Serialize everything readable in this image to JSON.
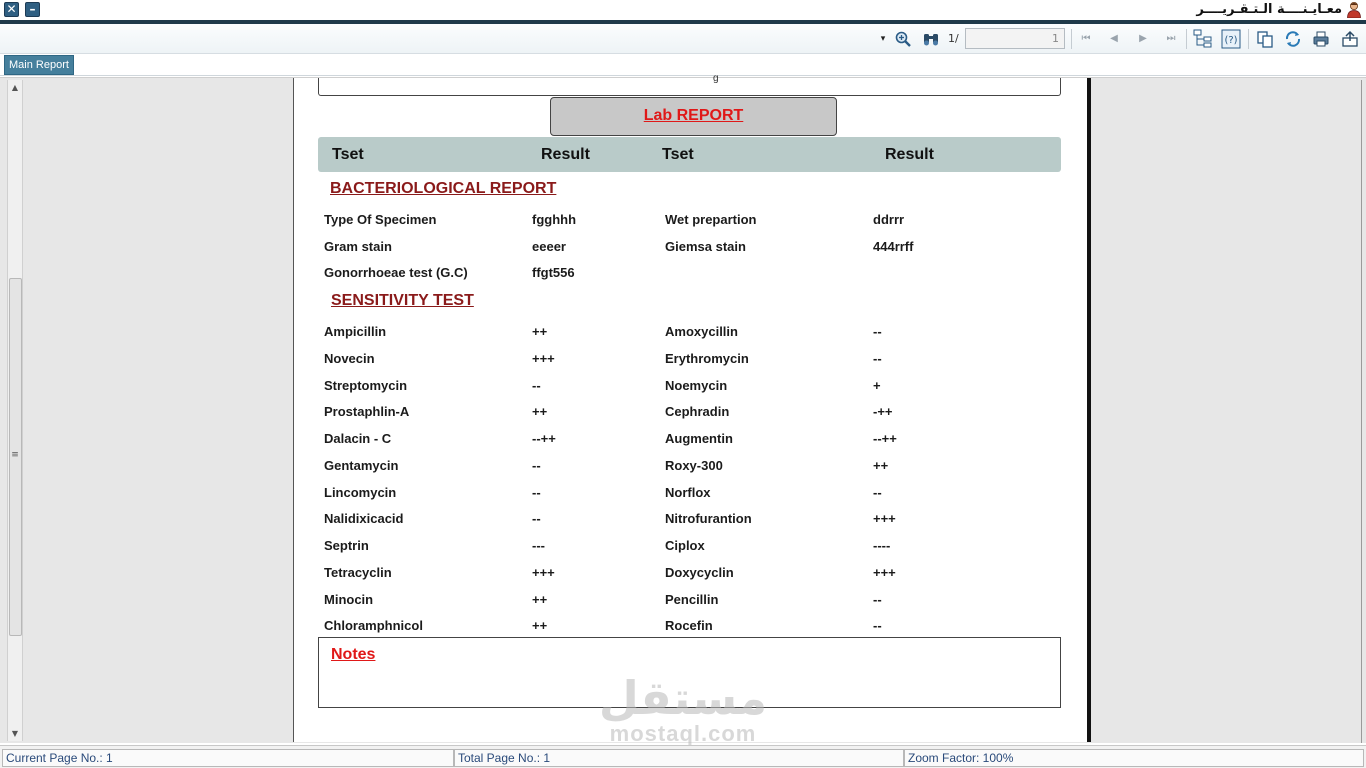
{
  "window": {
    "title": "معـايـنــــة الـتـقـريــــر",
    "close_glyph": "✕",
    "minimize_glyph": "–",
    "user_icon": "user-icon"
  },
  "toolbar": {
    "page_of_label": "1/",
    "page_input_value": "1",
    "icons": [
      "dropdown-arrow-icon",
      "zoom-icon",
      "search-binoculars-icon",
      "first-page-icon",
      "previous-page-icon",
      "next-page-icon",
      "last-page-icon",
      "group-tree-icon",
      "help-icon",
      "copy-icon",
      "refresh-icon",
      "print-icon",
      "export-icon"
    ]
  },
  "tabs": {
    "main_report": "Main Report"
  },
  "report": {
    "title": "Lab REPORT",
    "header": {
      "col1": "Tset",
      "col2": "Result",
      "col3": "Tset",
      "col4": "Result"
    },
    "bacteriological": {
      "title": "BACTERIOLOGICAL REPORT",
      "rows": [
        {
          "test1": "Type Of Specimen",
          "result1": "fgghhh",
          "test2": "Wet prepartion",
          "result2": "ddrrr"
        },
        {
          "test1": "Gram stain",
          "result1": "eeeer",
          "test2": "Giemsa stain",
          "result2": "444rrff"
        },
        {
          "test1": "Gonorrhoeae test (G.C)",
          "result1": "ffgt556",
          "test2": "",
          "result2": ""
        }
      ]
    },
    "sensitivity": {
      "title": "SENSITIVITY TEST",
      "rows": [
        {
          "test1": "Ampicillin",
          "result1": "++",
          "test2": "Amoxycillin",
          "result2": "--"
        },
        {
          "test1": "Novecin",
          "result1": "+++",
          "test2": "Erythromycin",
          "result2": "--"
        },
        {
          "test1": "Streptomycin",
          "result1": "--",
          "test2": "Noemycin",
          "result2": "+"
        },
        {
          "test1": "Prostaphlin-A",
          "result1": "++",
          "test2": "Cephradin",
          "result2": "-++"
        },
        {
          "test1": "Dalacin - C",
          "result1": "--++",
          "test2": "Augmentin",
          "result2": "--++"
        },
        {
          "test1": "Gentamycin",
          "result1": "--",
          "test2": "Roxy-300",
          "result2": "++"
        },
        {
          "test1": "Lincomycin",
          "result1": "--",
          "test2": "Norflox",
          "result2": "--"
        },
        {
          "test1": "Nalidixicacid",
          "result1": "--",
          "test2": "Nitrofurantion",
          "result2": "+++"
        },
        {
          "test1": "Septrin",
          "result1": "---",
          "test2": "Ciplox",
          "result2": "----"
        },
        {
          "test1": "Tetracyclin",
          "result1": "+++",
          "test2": "Doxycyclin",
          "result2": "+++"
        },
        {
          "test1": "Minocin",
          "result1": "++",
          "test2": "Pencillin",
          "result2": "--"
        },
        {
          "test1": "Chloramphnicol",
          "result1": "++",
          "test2": "Rocefin",
          "result2": "--"
        }
      ]
    },
    "notes": {
      "title": "Notes"
    }
  },
  "watermark": {
    "arabic": "مستقل",
    "latin": "mostaql.com"
  },
  "status": {
    "current_page": "Current Page No.: 1",
    "total_page": "Total Page No.: 1",
    "zoom": "Zoom Factor: 100%"
  }
}
